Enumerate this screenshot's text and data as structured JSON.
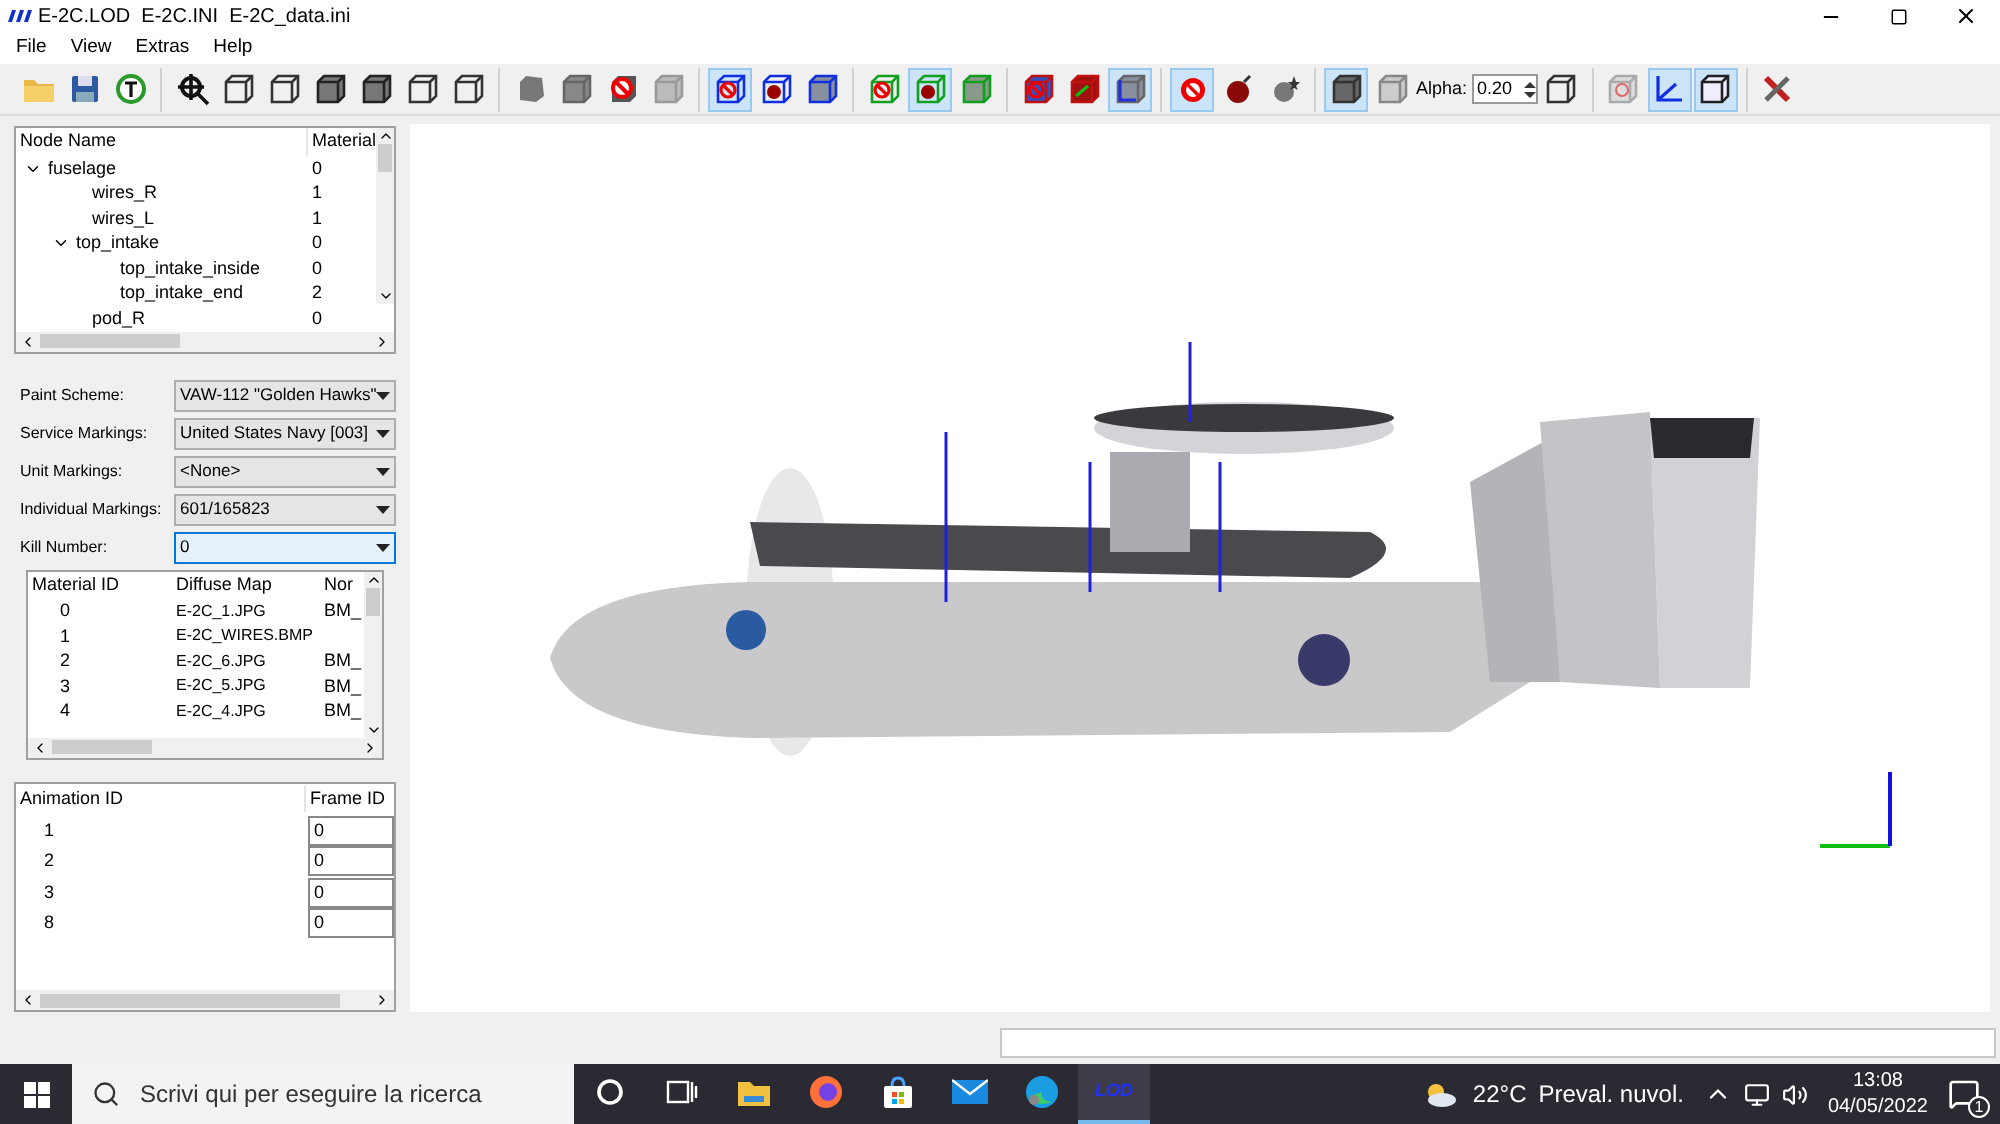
{
  "window": {
    "title": "E-2C.LOD  E-2C.INI  E-2C_data.ini"
  },
  "menu": [
    "File",
    "View",
    "Extras",
    "Help"
  ],
  "toolbar": {
    "groups": [
      {
        "items": [
          {
            "kind": "folder",
            "selected": false
          },
          {
            "kind": "disk",
            "selected": false
          },
          {
            "kind": "timer",
            "selected": false
          }
        ]
      },
      {
        "items": [
          {
            "kind": "crosshair",
            "selected": false
          },
          {
            "kind": "box",
            "selected": false
          },
          {
            "kind": "box",
            "selected": false
          },
          {
            "kind": "box-dark",
            "selected": false
          },
          {
            "kind": "box-dark",
            "selected": false
          },
          {
            "kind": "box",
            "selected": false
          },
          {
            "kind": "box",
            "selected": false
          }
        ]
      },
      {
        "items": [
          {
            "kind": "gray-blob",
            "selected": false
          },
          {
            "kind": "gray-cube",
            "selected": false
          },
          {
            "kind": "no-cube",
            "selected": false
          },
          {
            "kind": "light-cube",
            "selected": false
          }
        ]
      },
      {
        "items": [
          {
            "kind": "blue-no",
            "selected": true
          },
          {
            "kind": "blue-red",
            "selected": false
          },
          {
            "kind": "blue-gray",
            "selected": false
          }
        ]
      },
      {
        "items": [
          {
            "kind": "green-no",
            "selected": false
          },
          {
            "kind": "green-red",
            "selected": true
          },
          {
            "kind": "green-gray",
            "selected": false
          }
        ]
      },
      {
        "items": [
          {
            "kind": "red-no",
            "selected": false
          },
          {
            "kind": "red-green",
            "selected": false
          },
          {
            "kind": "red-axes",
            "selected": true
          }
        ]
      },
      {
        "items": [
          {
            "kind": "no-bomb",
            "selected": true
          },
          {
            "kind": "bomb",
            "selected": false
          },
          {
            "kind": "star-bomb",
            "selected": false
          }
        ]
      },
      {
        "items": [
          {
            "kind": "solid-cube",
            "selected": true
          },
          {
            "kind": "glass-cube",
            "selected": false
          },
          {
            "kind": "alpha",
            "label": "Alpha:",
            "value": "0.20"
          },
          {
            "kind": "wire-cube",
            "selected": false
          }
        ]
      },
      {
        "items": [
          {
            "kind": "ghost-cube",
            "selected": false
          },
          {
            "kind": "axes",
            "selected": true
          },
          {
            "kind": "outline-cube",
            "selected": true
          }
        ]
      },
      {
        "items": [
          {
            "kind": "tools",
            "selected": false
          }
        ]
      }
    ]
  },
  "tree": {
    "columns": [
      "Node Name",
      "Material"
    ],
    "nodes": [
      {
        "name": "fuselage",
        "material": "0",
        "expanded": true,
        "children": [
          {
            "name": "wires_R",
            "material": "1"
          },
          {
            "name": "wires_L",
            "material": "1"
          },
          {
            "name": "top_intake",
            "material": "0",
            "expanded": true,
            "children": [
              {
                "name": "top_intake_inside",
                "material": "0"
              },
              {
                "name": "top_intake_end",
                "material": "2"
              }
            ]
          },
          {
            "name": "pod_R",
            "material": "0"
          }
        ]
      }
    ]
  },
  "form": [
    {
      "label": "Paint Scheme:",
      "value": "VAW-112 \"Golden Hawks\"",
      "focused": false
    },
    {
      "label": "Service Markings:",
      "value": "United States Navy [003]",
      "focused": false
    },
    {
      "label": "Unit Markings:",
      "value": "<None>",
      "focused": false
    },
    {
      "label": "Individual Markings:",
      "value": "601/165823",
      "focused": false
    },
    {
      "label": "Kill Number:",
      "value": "0",
      "focused": true
    }
  ],
  "materials": {
    "columns": [
      "Material ID",
      "Diffuse Map",
      "Nor"
    ],
    "rows": [
      [
        "0",
        "E-2C_1.JPG",
        "BM_"
      ],
      [
        "1",
        "E-2C_WIRES.BMP",
        ""
      ],
      [
        "2",
        "E-2C_6.JPG",
        "BM_"
      ],
      [
        "3",
        "E-2C_5.JPG",
        "BM_"
      ],
      [
        "4",
        "E-2C_4.JPG",
        "BM_"
      ]
    ]
  },
  "animations": {
    "columns": [
      "Animation ID",
      "Frame ID"
    ],
    "rows": [
      {
        "id": "1",
        "frame": "0"
      },
      {
        "id": "2",
        "frame": "0"
      },
      {
        "id": "3",
        "frame": "0"
      },
      {
        "id": "8",
        "frame": "0"
      }
    ]
  },
  "viewport": {
    "kind": "picture"
  },
  "taskbar": {
    "search_placeholder": "Scrivi qui per eseguire la ricerca",
    "apps": [
      {
        "kind": "cortana",
        "selected": false
      },
      {
        "kind": "taskview",
        "selected": false
      },
      {
        "kind": "explorer",
        "selected": false
      },
      {
        "kind": "firefox",
        "selected": false
      },
      {
        "kind": "store",
        "selected": false
      },
      {
        "kind": "mail",
        "selected": false
      },
      {
        "kind": "edge",
        "selected": false
      },
      {
        "kind": "lod",
        "label": "LOD",
        "selected": true
      }
    ],
    "temperature": "22°C",
    "weather": "Preval. nuvol.",
    "time": "13:08",
    "date": "04/05/2022",
    "notifications": "1"
  }
}
